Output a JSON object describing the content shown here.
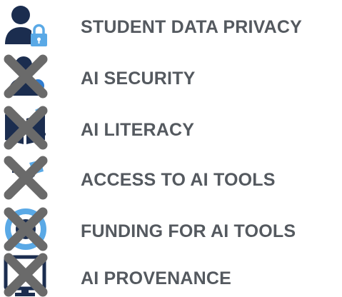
{
  "items": [
    {
      "label": "STUDENT DATA PRIVACY",
      "icon": "user-lock-icon",
      "crossed_out": false
    },
    {
      "label": "AI SECURITY",
      "icon": "security-icon",
      "crossed_out": true
    },
    {
      "label": "AI LITERACY",
      "icon": "literacy-icon",
      "crossed_out": true
    },
    {
      "label": "ACCESS TO AI TOOLS",
      "icon": "tools-access-icon",
      "crossed_out": true
    },
    {
      "label": "FUNDING FOR AI TOOLS",
      "icon": "funding-icon",
      "crossed_out": true
    },
    {
      "label": "AI PROVENANCE",
      "icon": "provenance-icon",
      "crossed_out": true
    }
  ],
  "colors": {
    "label_text": "#54595f",
    "icon_navy": "#1b2d4f",
    "icon_blue": "#2f7dd1",
    "icon_light_blue": "#5aa9e6",
    "cross_gray": "#6a6a6a"
  }
}
